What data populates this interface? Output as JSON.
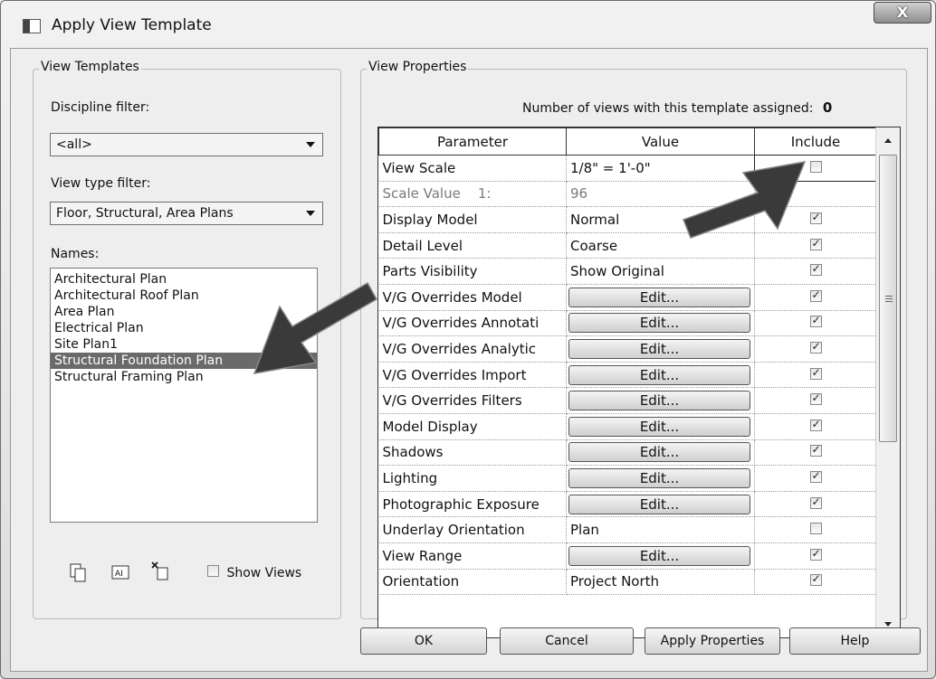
{
  "title": "Apply View Template",
  "close_glyph": "X",
  "view_templates": {
    "group_title": "View Templates",
    "discipline_label": "Discipline filter:",
    "discipline_value": "<all>",
    "view_type_label": "View type filter:",
    "view_type_value": "Floor, Structural, Area Plans",
    "names_label": "Names:",
    "names": [
      "Architectural Plan",
      "Architectural Roof Plan",
      "Area Plan",
      "Electrical Plan",
      "Site Plan1",
      "Structural Foundation Plan",
      "Structural Framing Plan"
    ],
    "selected_index": 5,
    "duplicate_icon": "duplicate-icon",
    "rename_icon": "rename-icon",
    "delete_icon": "delete-icon",
    "show_views_label": "Show Views",
    "show_views_checked": false
  },
  "view_properties": {
    "group_title": "View Properties",
    "assigned_label": "Number of views with this template assigned:",
    "assigned_count": "0",
    "headers": [
      "Parameter",
      "Value",
      "Include"
    ],
    "rows": [
      {
        "parameter": "View Scale",
        "value": "1/8\" = 1'-0\"",
        "kind": "text",
        "include": false
      },
      {
        "parameter": "Scale Value    1:",
        "value": "96",
        "kind": "grayed",
        "include": null
      },
      {
        "parameter": "Display Model",
        "value": "Normal",
        "kind": "text",
        "include": true
      },
      {
        "parameter": "Detail Level",
        "value": "Coarse",
        "kind": "text",
        "include": true
      },
      {
        "parameter": "Parts Visibility",
        "value": "Show Original",
        "kind": "text",
        "include": true
      },
      {
        "parameter": "V/G Overrides Model",
        "value": "Edit...",
        "kind": "button",
        "include": true
      },
      {
        "parameter": "V/G Overrides Annotati",
        "value": "Edit...",
        "kind": "button",
        "include": true
      },
      {
        "parameter": "V/G Overrides Analytic",
        "value": "Edit...",
        "kind": "button",
        "include": true
      },
      {
        "parameter": "V/G Overrides Import",
        "value": "Edit...",
        "kind": "button",
        "include": true
      },
      {
        "parameter": "V/G Overrides Filters",
        "value": "Edit...",
        "kind": "button",
        "include": true
      },
      {
        "parameter": "Model Display",
        "value": "Edit...",
        "kind": "button",
        "include": true
      },
      {
        "parameter": "Shadows",
        "value": "Edit...",
        "kind": "button",
        "include": true
      },
      {
        "parameter": "Lighting",
        "value": "Edit...",
        "kind": "button",
        "include": true
      },
      {
        "parameter": "Photographic Exposure",
        "value": "Edit...",
        "kind": "button",
        "include": true
      },
      {
        "parameter": "Underlay Orientation",
        "value": "Plan",
        "kind": "text",
        "include": false
      },
      {
        "parameter": "View Range",
        "value": "Edit...",
        "kind": "button",
        "include": true
      },
      {
        "parameter": "Orientation",
        "value": "Project North",
        "kind": "text",
        "include": true
      }
    ],
    "scroll_grip": "≡"
  },
  "buttons": {
    "ok": "OK",
    "cancel": "Cancel",
    "apply_properties": "Apply Properties",
    "help": "Help"
  }
}
